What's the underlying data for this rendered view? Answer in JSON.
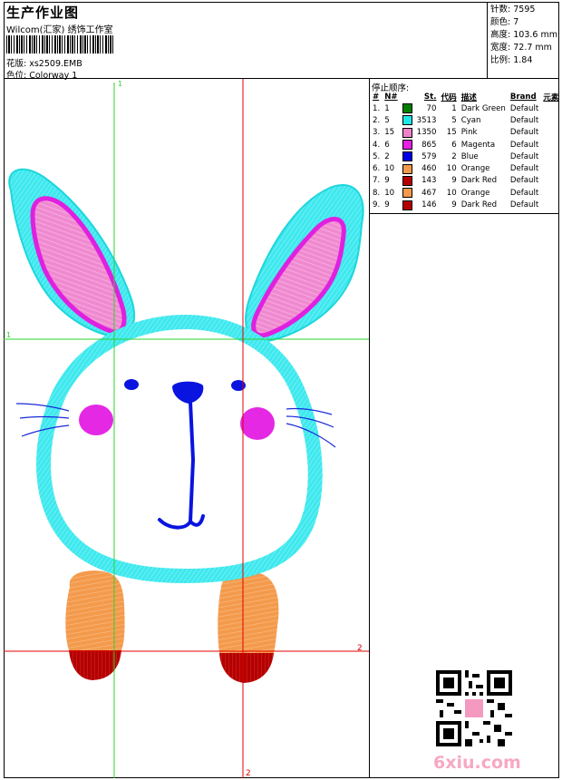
{
  "header": {
    "title": "生产作业图",
    "subtitle": "Wilcom(汇家) 绣饰工作室",
    "design_label": "花版:",
    "design_value": "xs2509.EMB",
    "colorway_label": "色位:",
    "colorway_value": "Colorway 1"
  },
  "specs": [
    {
      "label": "针数:",
      "value": "7595"
    },
    {
      "label": "颜色:",
      "value": "7"
    },
    {
      "label": "高度:",
      "value": "103.6 mm"
    },
    {
      "label": "宽度:",
      "value": "72.7 mm"
    },
    {
      "label": "比例:",
      "value": "1.84"
    }
  ],
  "stop_sequence": {
    "title": "停止顺序:",
    "headers": [
      "#",
      "N#",
      "St.",
      "代码",
      "描述",
      "Brand",
      "元素"
    ],
    "rows": [
      {
        "num": "1.",
        "n": "1",
        "color": "#008000",
        "st": "70",
        "code": "1",
        "desc": "Dark Green",
        "brand": "Default"
      },
      {
        "num": "2.",
        "n": "5",
        "color": "#1ee6e6",
        "st": "3513",
        "code": "5",
        "desc": "Cyan",
        "brand": "Default"
      },
      {
        "num": "3.",
        "n": "15",
        "color": "#ee82c8",
        "st": "1350",
        "code": "15",
        "desc": "Pink",
        "brand": "Default"
      },
      {
        "num": "4.",
        "n": "6",
        "color": "#e61ee6",
        "st": "865",
        "code": "6",
        "desc": "Magenta",
        "brand": "Default"
      },
      {
        "num": "5.",
        "n": "2",
        "color": "#0000e6",
        "st": "579",
        "code": "2",
        "desc": "Blue",
        "brand": "Default"
      },
      {
        "num": "6.",
        "n": "10",
        "color": "#f2994a",
        "st": "460",
        "code": "10",
        "desc": "Orange",
        "brand": "Default"
      },
      {
        "num": "7.",
        "n": "9",
        "color": "#b40000",
        "st": "143",
        "code": "9",
        "desc": "Dark Red",
        "brand": "Default"
      },
      {
        "num": "8.",
        "n": "10",
        "color": "#f2994a",
        "st": "467",
        "code": "10",
        "desc": "Orange",
        "brand": "Default"
      },
      {
        "num": "9.",
        "n": "9",
        "color": "#b40000",
        "st": "146",
        "code": "9",
        "desc": "Dark Red",
        "brand": "Default"
      }
    ]
  },
  "guides": {
    "v1_label": "1",
    "h1_label": "1",
    "h2_label": "2",
    "v2_label": "2"
  },
  "watermark": {
    "text": "6xiu.com"
  }
}
